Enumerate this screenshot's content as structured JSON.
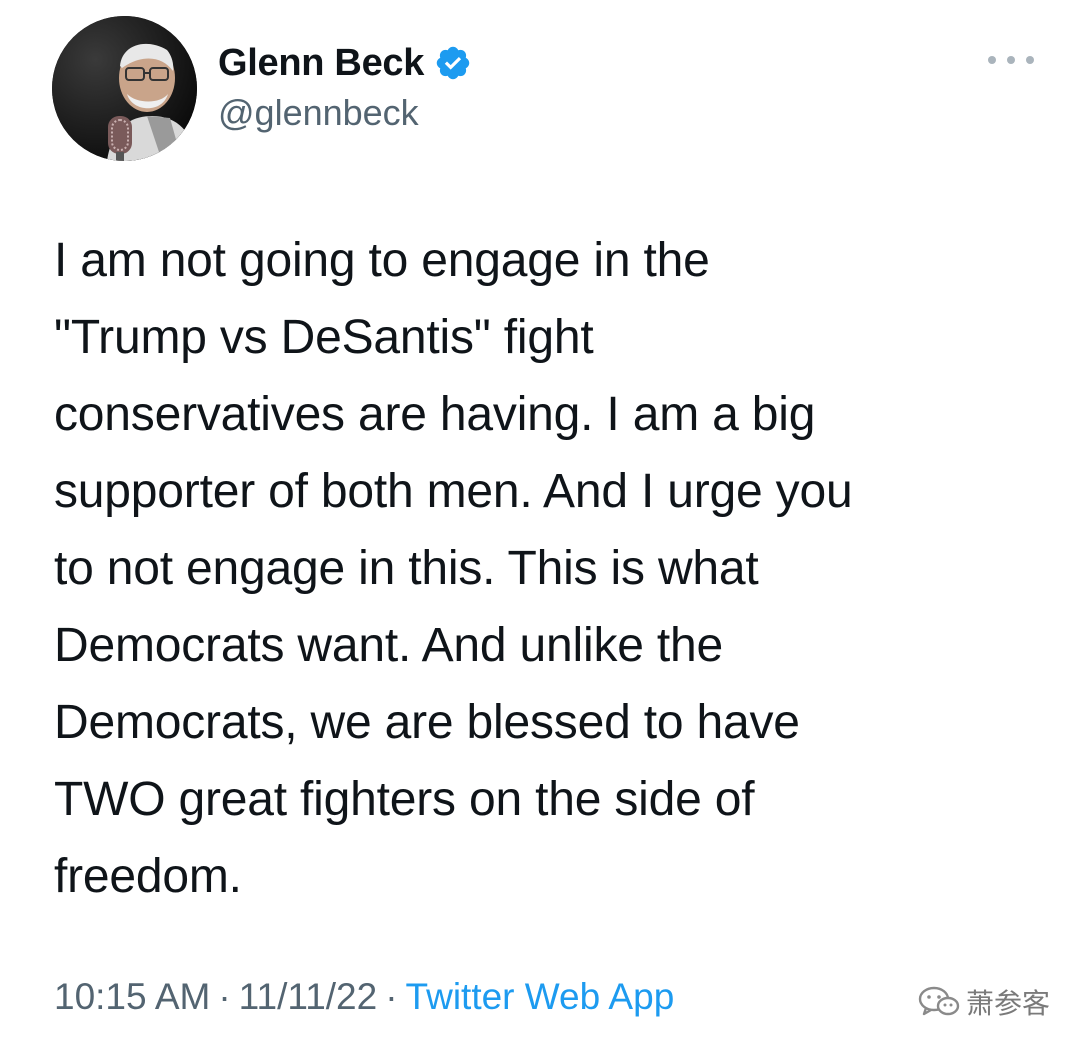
{
  "author": {
    "display_name": "Glenn Beck",
    "handle": "@glennbeck",
    "verified": true,
    "avatar_icon": "profile-photo"
  },
  "tweet": {
    "text": "I am not going to engage in the\n\"Trump vs DeSantis\" fight\nconservatives are having. I am a big\nsupporter of both men. And I urge you\nto not engage in this. This is what\nDemocrats want. And unlike the\nDemocrats, we are blessed to have\nTWO great fighters on the side of\nfreedom.",
    "time": "10:15 AM",
    "date": "11/11/22",
    "separator": "·",
    "source": "Twitter Web App"
  },
  "watermark": {
    "icon": "wechat-icon",
    "text": "萧参客"
  },
  "colors": {
    "text": "#0f1419",
    "secondary": "#536471",
    "accent": "#1d9bf0"
  }
}
